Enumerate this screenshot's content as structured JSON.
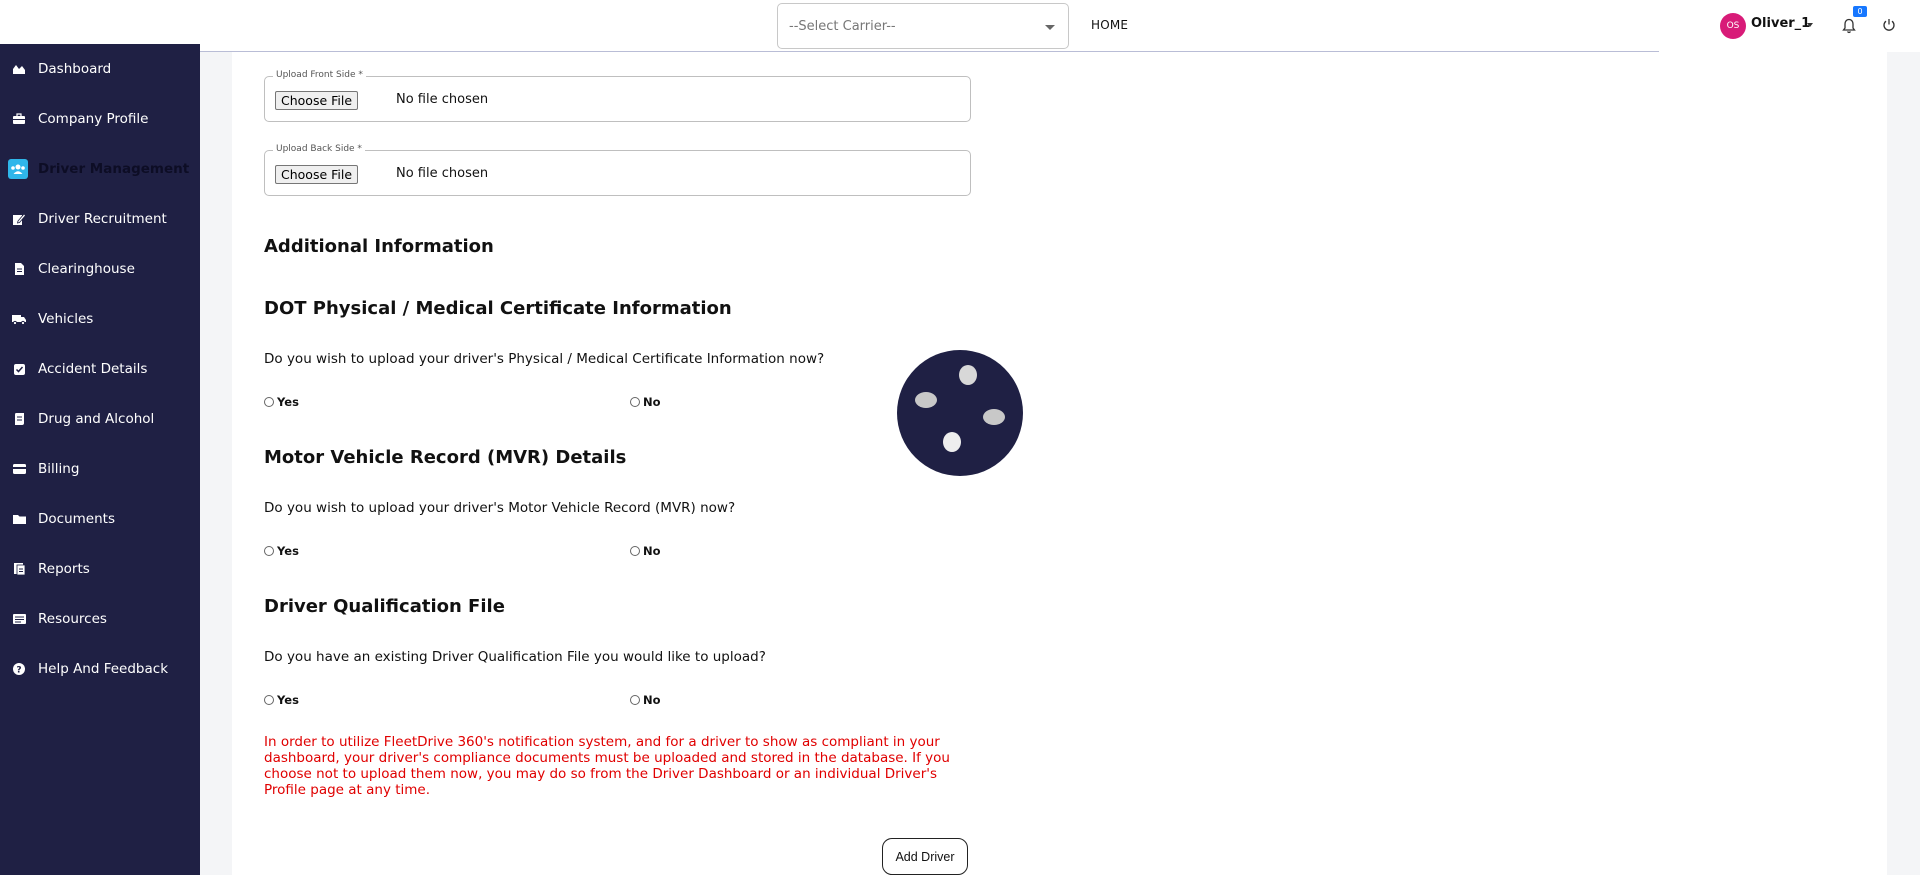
{
  "topbar": {
    "carrier_select": "--Select Carrier--",
    "home_label": "HOME",
    "user_initials": "OS",
    "user_name": "Oliver_1",
    "notification_count": "0"
  },
  "sidebar": {
    "items": [
      {
        "label": "Dashboard",
        "icon": "dashboard-icon"
      },
      {
        "label": "Company Profile",
        "icon": "briefcase-icon"
      },
      {
        "label": "Driver Management",
        "icon": "users-icon",
        "active": true
      },
      {
        "label": "Driver Recruitment",
        "icon": "edit-icon"
      },
      {
        "label": "Clearinghouse",
        "icon": "document-icon"
      },
      {
        "label": "Vehicles",
        "icon": "truck-icon"
      },
      {
        "label": "Accident Details",
        "icon": "checkbox-icon"
      },
      {
        "label": "Drug and Alcohol",
        "icon": "scroll-icon"
      },
      {
        "label": "Billing",
        "icon": "card-icon"
      },
      {
        "label": "Documents",
        "icon": "folder-icon"
      },
      {
        "label": "Reports",
        "icon": "report-icon"
      },
      {
        "label": "Resources",
        "icon": "resources-icon"
      },
      {
        "label": "Help And Feedback",
        "icon": "help-icon"
      }
    ]
  },
  "form": {
    "front": {
      "legend": "Upload Front Side *",
      "button": "Choose File",
      "status": "No file chosen"
    },
    "back": {
      "legend": "Upload Back Side *",
      "button": "Choose File",
      "status": "No file chosen"
    },
    "additional_title": "Additional Information",
    "dot_title": "DOT Physical / Medical Certificate Information",
    "dot_question": "Do you wish to upload your driver's Physical / Medical Certificate Information now?",
    "mvr_title": "Motor Vehicle Record (MVR) Details",
    "mvr_question": "Do you wish to upload your driver's Motor Vehicle Record (MVR) now?",
    "dqf_title": "Driver Qualification File",
    "dqf_question": "Do you have an existing Driver Qualification File you would like to upload?",
    "yes_label": "Yes",
    "no_label": "No",
    "notice": "In order to utilize FleetDrive 360's notification system, and for a driver to show as compliant in your dashboard, your driver's compliance documents must be uploaded and stored in the database. If you choose not to upload them now, you may do so from the Driver Dashboard or an individual Driver's Profile page at any time.",
    "add_driver": "Add Driver"
  },
  "colors": {
    "sidebar_bg": "#1f2044",
    "active_icon_bg": "#2fb6ea",
    "notice": "#e00000",
    "avatar": "#d81b78",
    "badge": "#1677ff"
  }
}
